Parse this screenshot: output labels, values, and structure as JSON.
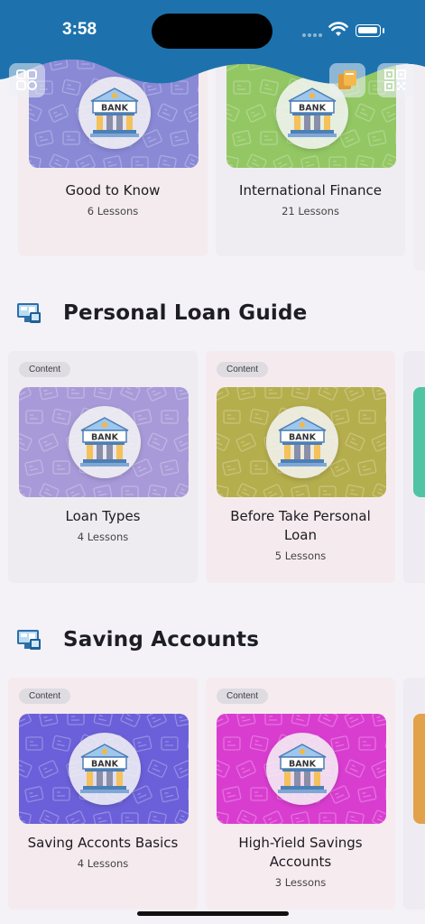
{
  "status_bar": {
    "time": "3:58"
  },
  "top_cards": [
    {
      "title": "Good to Know",
      "lessons": "6 Lessons",
      "color": "#8a89d6",
      "bg": "#f3ebed"
    },
    {
      "title": "International Finance",
      "lessons": "21 Lessons",
      "color": "#93c764",
      "bg": "#efedf1"
    }
  ],
  "sections": [
    {
      "title": "Personal Loan Guide",
      "cards": [
        {
          "chip": "Content",
          "title": "Loan Types",
          "lessons": "4 Lessons",
          "color": "#a89ad8",
          "bg": "#efecf1"
        },
        {
          "chip": "Content",
          "title": "Before Take Personal Loan",
          "lessons": "5 Lessons",
          "color": "#b5ae4d",
          "bg": "#f5ebee"
        }
      ]
    },
    {
      "title": "Saving Accounts",
      "cards": [
        {
          "chip": "Content",
          "title": "Saving Acconts Basics",
          "lessons": "4 Lessons",
          "color": "#6b60d9",
          "bg": "#f5eaee"
        },
        {
          "chip": "Content",
          "title": "High-Yield Savings Accounts",
          "lessons": "3 Lessons",
          "color": "#d93dd0",
          "bg": "#f6ebef"
        }
      ]
    }
  ],
  "badge_text": "BANK",
  "icons": {
    "menu": "grid-menu-icon",
    "book": "book-icon",
    "qr": "qr-code-icon",
    "section": "computer-screen-icon"
  }
}
